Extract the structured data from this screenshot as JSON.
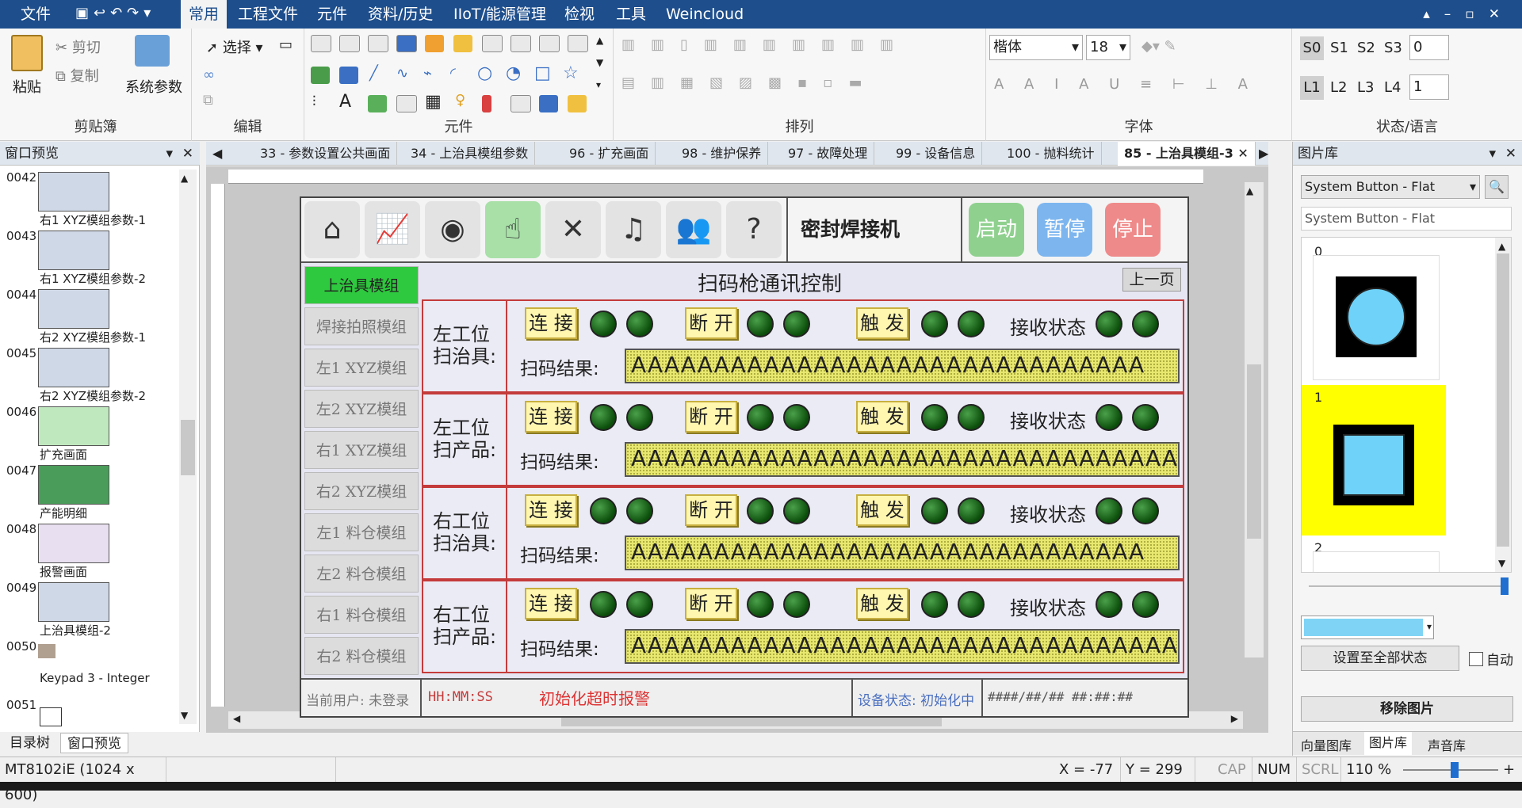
{
  "menubar": {
    "file": "文件",
    "tabs": [
      "常用",
      "工程文件",
      "元件",
      "资料/历史",
      "IIoT/能源管理",
      "检视",
      "工具",
      "Weincloud"
    ]
  },
  "ribbon": {
    "clipboard": {
      "label": "剪贴簿",
      "paste": "粘贴",
      "cut": "剪切",
      "copy": "复制",
      "sysparam": "系统参数"
    },
    "edit": {
      "label": "编辑",
      "select": "选择"
    },
    "parts": {
      "label": "元件"
    },
    "arrange": {
      "label": "排列"
    },
    "font": {
      "label": "字体",
      "family": "楷体",
      "size": "18"
    },
    "state": {
      "label": "状态/语言",
      "s_items": [
        "S0",
        "S1",
        "S2",
        "S3"
      ],
      "s_value": "0",
      "l_items": [
        "L1",
        "L2",
        "L3",
        "L4"
      ],
      "l_value": "1"
    }
  },
  "left_panel": {
    "title": "窗口预览",
    "items": [
      {
        "num": "0042",
        "caption": "右1 XYZ模组参数-1"
      },
      {
        "num": "0043",
        "caption": "右1 XYZ模组参数-2"
      },
      {
        "num": "0044",
        "caption": "右2 XYZ模组参数-1"
      },
      {
        "num": "0045",
        "caption": "右2 XYZ模组参数-2"
      },
      {
        "num": "0046",
        "caption": "扩充画面"
      },
      {
        "num": "0047",
        "caption": "产能明细"
      },
      {
        "num": "0048",
        "caption": "报警画面"
      },
      {
        "num": "0049",
        "caption": "上治具模组-2"
      },
      {
        "num": "0050",
        "caption": "Keypad 3 - Integer"
      },
      {
        "num": "0051",
        "caption": ""
      }
    ],
    "tabs": [
      "目录树",
      "窗口预览"
    ]
  },
  "doc_tabs": [
    "33 - 参数设置公共画面",
    "34 - 上治具模组参数",
    "96 - 扩充画面",
    "98 - 维护保养",
    "97 - 故障处理",
    "99 - 设备信息",
    "100 - 抛料统计",
    "85 - 上治具模组-3"
  ],
  "hmi": {
    "machine_name": "密封焊接机",
    "start": "启动",
    "pause": "暂停",
    "stop": "停止",
    "page_title": "扫码枪通讯控制",
    "prev_page": "上一页",
    "side_buttons": [
      "上治具模组",
      "焊接拍照模组",
      "左1 XYZ模组",
      "左2 XYZ模组",
      "右1 XYZ模组",
      "右2 XYZ模组",
      "左1 料仓模组",
      "左2 料仓模组",
      "右1 料仓模组",
      "右2 料仓模组"
    ],
    "sections": [
      {
        "title_line1": "左工位",
        "title_line2": "扫治具:",
        "result": "AAAAAAAAAAAAAAAAAAAAAAAAAAAAAAA"
      },
      {
        "title_line1": "左工位",
        "title_line2": "扫产品:",
        "result": "AAAAAAAAAAAAAAAAAAAAAAAAAAAAAAAAAAAAA"
      },
      {
        "title_line1": "右工位",
        "title_line2": "扫治具:",
        "result": "AAAAAAAAAAAAAAAAAAAAAAAAAAAAAAA"
      },
      {
        "title_line1": "右工位",
        "title_line2": "扫产品:",
        "result": "AAAAAAAAAAAAAAAAAAAAAAAAAAAAAAAAAAAAA"
      }
    ],
    "btn_connect": "连 接",
    "btn_disconnect": "断 开",
    "btn_trigger": "触 发",
    "recv_status": "接收状态",
    "scan_result": "扫码结果:",
    "footer": {
      "user": "当前用户: 未登录",
      "time": "HH:MM:SS",
      "alarm": "初始化超时报警",
      "device_state": "设备状态: 初始化中",
      "datetime": "####/##/## ##:##:##"
    }
  },
  "right_panel": {
    "title": "图片库",
    "lib_select": "System Button - Flat",
    "lib_name": "System Button - Flat",
    "items": [
      "0",
      "1",
      "2"
    ],
    "set_all": "设置至全部状态",
    "auto": "自动",
    "remove": "移除图片",
    "tabs": [
      "向量图库",
      "图片库",
      "声音库"
    ],
    "selected_color": "#7fd4f5"
  },
  "statusbar": {
    "model": "MT8102iE (1024 x 600)",
    "x": "X = -77",
    "y": "Y = 299",
    "cap": "CAP",
    "num": "NUM",
    "scrl": "SCRL",
    "zoom": "110 %"
  }
}
